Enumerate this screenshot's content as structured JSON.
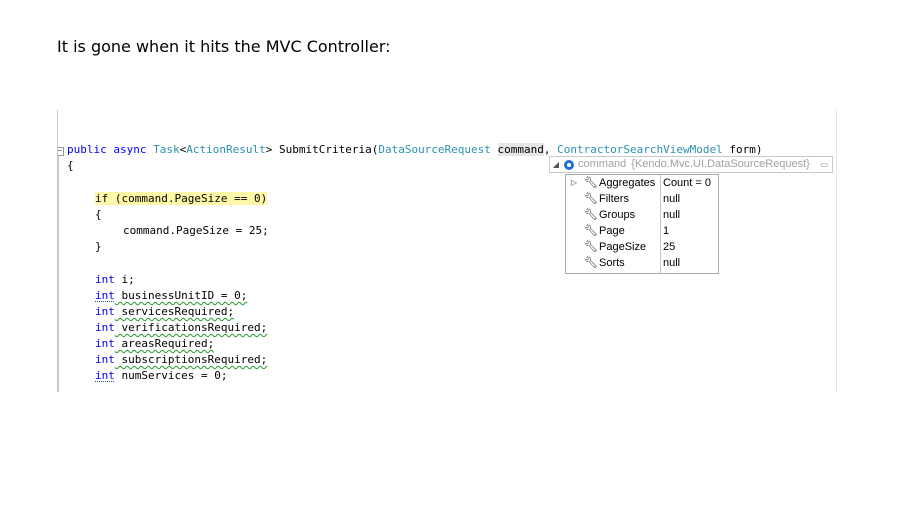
{
  "caption": "It is gone when it hits the MVC Controller:",
  "code": {
    "sig": {
      "public": "public",
      "async": "async",
      "task": "Task",
      "lt": "<",
      "action_result": "ActionResult",
      "gt": ">",
      "method": " SubmitCriteria(",
      "dsr_type": "DataSourceRequest",
      "command": "command",
      "comma": ", ",
      "vm_type": "ContractorSearchViewModel",
      "form": " form)"
    },
    "open_brace": "{",
    "if_line": "if (command.PageSize == 0)",
    "open_brace2": "{",
    "assign_line": "command.PageSize = 25;",
    "close_brace2": "}",
    "decls": [
      {
        "kw": "int",
        "rest": " i;"
      },
      {
        "kw": "int",
        "rest": " businessUnitID = 0;"
      },
      {
        "kw": "int",
        "rest": " servicesRequired;"
      },
      {
        "kw": "int",
        "rest": " verificationsRequired;"
      },
      {
        "kw": "int",
        "rest": " areasRequired;"
      },
      {
        "kw": "int",
        "rest": " subscriptionsRequired;"
      },
      {
        "kw": "int",
        "rest": " numServices = 0;"
      }
    ]
  },
  "datatip": {
    "header_name": "command",
    "header_type": "{Kendo.Mvc.UI.DataSourceRequest}",
    "rows": [
      {
        "name": "Aggregates",
        "value": "Count = 0"
      },
      {
        "name": "Filters",
        "value": "null"
      },
      {
        "name": "Groups",
        "value": "null"
      },
      {
        "name": "Page",
        "value": "1"
      },
      {
        "name": "PageSize",
        "value": "25"
      },
      {
        "name": "Sorts",
        "value": "null"
      }
    ]
  },
  "colors": {
    "keyword": "#0000ff",
    "type": "#2b91af",
    "highlight": "#fff8a8"
  },
  "icons": {
    "expand": "triangle-right-icon",
    "collapse": "triangle-down-icon",
    "object": "object-icon",
    "property": "wrench-icon",
    "pin": "pin-icon"
  }
}
